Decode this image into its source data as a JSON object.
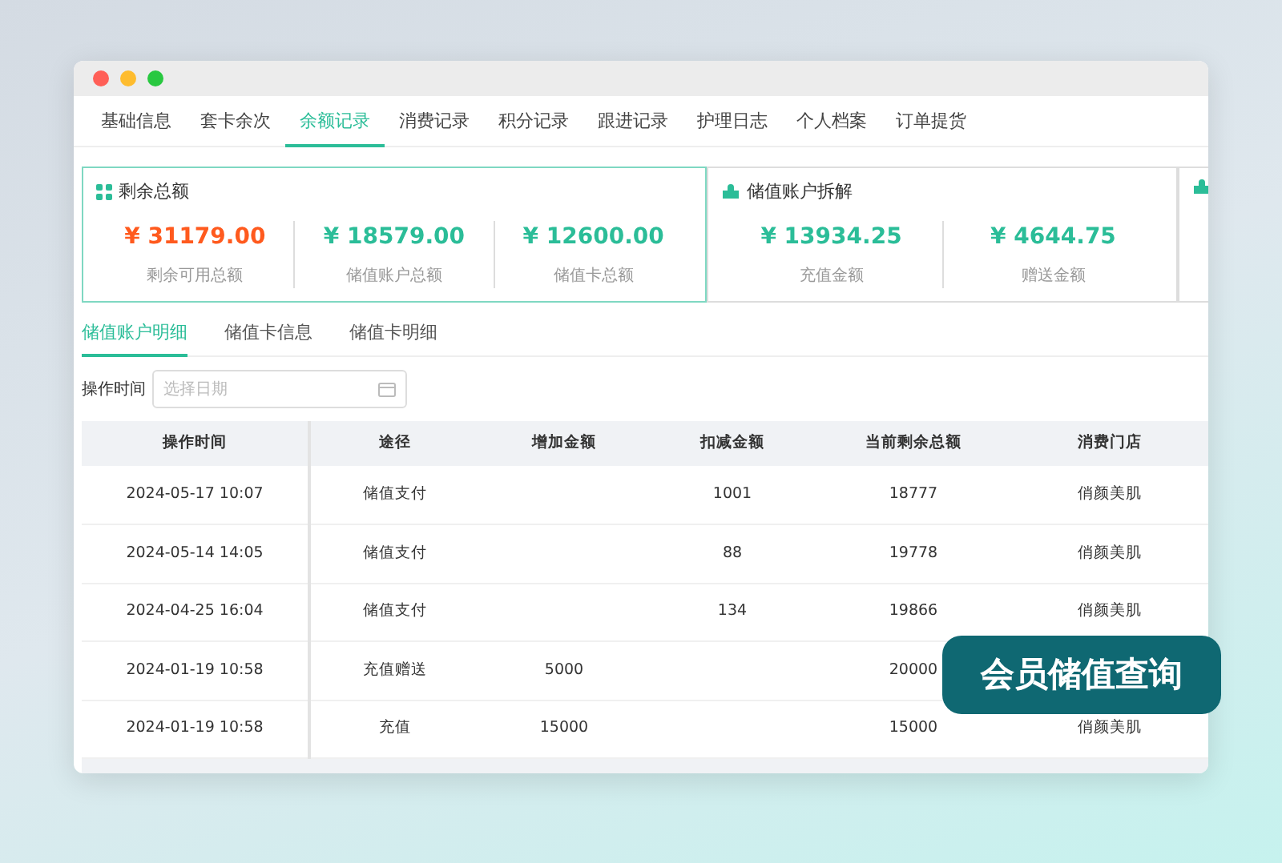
{
  "tabs": [
    {
      "label": "基础信息",
      "selected": false
    },
    {
      "label": "套卡余次",
      "selected": false
    },
    {
      "label": "余额记录",
      "selected": true
    },
    {
      "label": "消费记录",
      "selected": false
    },
    {
      "label": "积分记录",
      "selected": false
    },
    {
      "label": "跟进记录",
      "selected": false
    },
    {
      "label": "护理日志",
      "selected": false
    },
    {
      "label": "个人档案",
      "selected": false
    },
    {
      "label": "订单提货",
      "selected": false
    }
  ],
  "summary_cards": [
    {
      "kind": "grid",
      "title": "剩余总额",
      "selected": true,
      "stats": [
        {
          "value": "¥ 31179.00",
          "label": "剩余可用总额",
          "color": "#ff5a1e"
        },
        {
          "value": "¥ 18579.00",
          "label": "储值账户总额",
          "color": "#2bbd98"
        },
        {
          "value": "¥ 12600.00",
          "label": "储值卡总额",
          "color": "#2bbd98"
        }
      ]
    },
    {
      "kind": "split",
      "title": "储值账户拆解",
      "selected": false,
      "stats": [
        {
          "value": "¥ 13934.25",
          "label": "充值金额",
          "color": "#2bbd98"
        },
        {
          "value": "¥ 4644.75",
          "label": "赠送金额",
          "color": "#2bbd98"
        }
      ]
    },
    {
      "kind": "split",
      "selected": false
    }
  ],
  "sub_tabs": [
    {
      "label": "储值账户明细",
      "selected": true
    },
    {
      "label": "储值卡信息",
      "selected": false
    },
    {
      "label": "储值卡明细",
      "selected": false
    }
  ],
  "filter": {
    "label": "操作时间",
    "placeholder": "选择日期"
  },
  "table": {
    "columns": [
      "操作时间",
      "途径",
      "增加金额",
      "扣减金额",
      "当前剩余总额",
      "消费门店"
    ],
    "rows": [
      {
        "time": "2024-05-17 10:07",
        "channel": "储值支付",
        "deducted": "1001",
        "balance": "18777",
        "store": "俏颜美肌"
      },
      {
        "time": "2024-05-14 14:05",
        "channel": "储值支付",
        "deducted": "88",
        "balance": "19778",
        "store": "俏颜美肌"
      },
      {
        "time": "2024-04-25 16:04",
        "channel": "储值支付",
        "deducted": "134",
        "balance": "19866",
        "store": "俏颜美肌"
      },
      {
        "time": "2024-01-19 10:58",
        "channel": "充值赠送",
        "added": "5000",
        "balance": "20000"
      },
      {
        "time": "2024-01-19 10:58",
        "channel": "充值",
        "added": "15000",
        "balance": "15000",
        "store": "俏颜美肌"
      }
    ]
  },
  "overlay_badge": "会员储值查询"
}
